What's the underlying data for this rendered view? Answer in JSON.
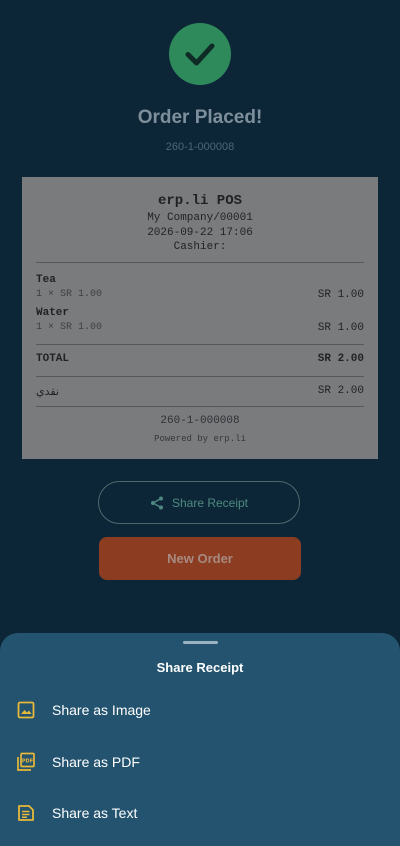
{
  "screen": {
    "title": "Order Placed!",
    "order_number": "260-1-000008"
  },
  "receipt": {
    "store_name": "erp.li POS",
    "company": "My Company/00001",
    "datetime": "2026-09-22 17:06",
    "cashier": "Cashier:",
    "items": [
      {
        "name": "Tea",
        "qty_price": "1 × SR 1.00",
        "amount": "SR 1.00"
      },
      {
        "name": "Water",
        "qty_price": "1 × SR 1.00",
        "amount": "SR 1.00"
      }
    ],
    "total_label": "TOTAL",
    "total_amount": "SR 2.00",
    "payment_label": "نقدي",
    "payment_amount": "SR 2.00",
    "footer_order_number": "260-1-000008",
    "powered_by": "Powered by erp.li"
  },
  "buttons": {
    "share_receipt": "Share Receipt",
    "new_order": "New Order"
  },
  "sheet": {
    "title": "Share Receipt",
    "options": [
      {
        "label": "Share as Image",
        "icon": "image-icon"
      },
      {
        "label": "Share as PDF",
        "icon": "pdf-icon"
      },
      {
        "label": "Share as Text",
        "icon": "text-document-icon"
      }
    ]
  },
  "colors": {
    "background": "#0d2637",
    "success": "#2e8a5b",
    "primary_button": "#8c3d21",
    "sheet": "#23536f",
    "icon_accent": "#e8b83a"
  }
}
